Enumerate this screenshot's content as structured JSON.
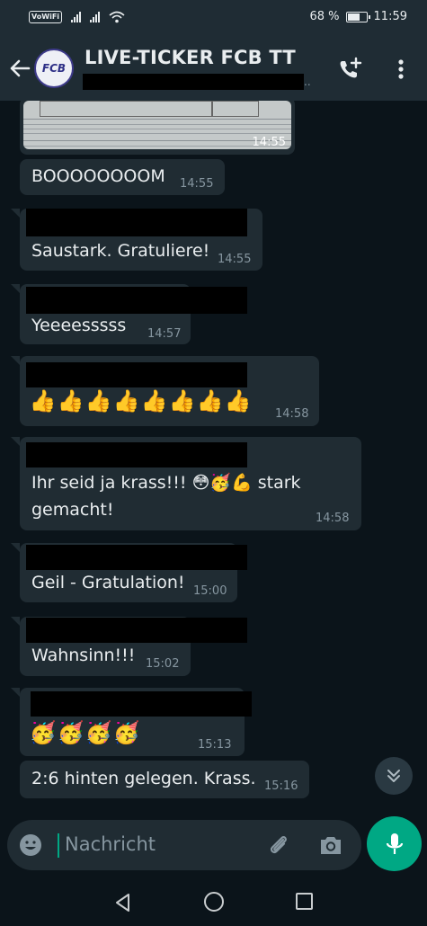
{
  "status_bar": {
    "network_label": "VoWiFi",
    "battery": "68 %",
    "time": "11:59"
  },
  "header": {
    "title": "LIVE-TICKER FCB TT",
    "avatar_text": "FCB",
    "icons": [
      "back-arrow-icon",
      "add-call-icon",
      "more-vert-icon"
    ]
  },
  "messages": [
    {
      "type": "photo",
      "time": "14:55"
    },
    {
      "text": "BOOOOOOOOM",
      "time": "14:55"
    },
    {
      "text": "Saustark. Gratuliere!",
      "time": "14:55"
    },
    {
      "text": "Yeeeesssss",
      "time": "14:57"
    },
    {
      "emoji": [
        "👍",
        "👍",
        "👍",
        "👍",
        "👍",
        "👍",
        "👍",
        "👍"
      ],
      "time": "14:58"
    },
    {
      "text_line1": "Ihr seid ja krass!!! 😳🥳💪 stark",
      "text_line2": "gemacht!",
      "time": "14:58"
    },
    {
      "text": "Geil - Gratulation!",
      "time": "15:00"
    },
    {
      "text": "Wahnsinn!!!",
      "time": "15:02"
    },
    {
      "emoji": [
        "🥳",
        "🥳",
        "🥳",
        "🥳"
      ],
      "time": "15:13"
    },
    {
      "text": "2:6 hinten gelegen. Krass.",
      "time": "15:16"
    }
  ],
  "composer": {
    "placeholder": "Nachricht",
    "icons": [
      "emoji-icon",
      "attach-icon",
      "camera-icon",
      "mic-icon"
    ]
  },
  "colors": {
    "background": "#0b141a",
    "bar": "#1f2c34",
    "bubble": "#202c33",
    "accent": "#00a884"
  }
}
